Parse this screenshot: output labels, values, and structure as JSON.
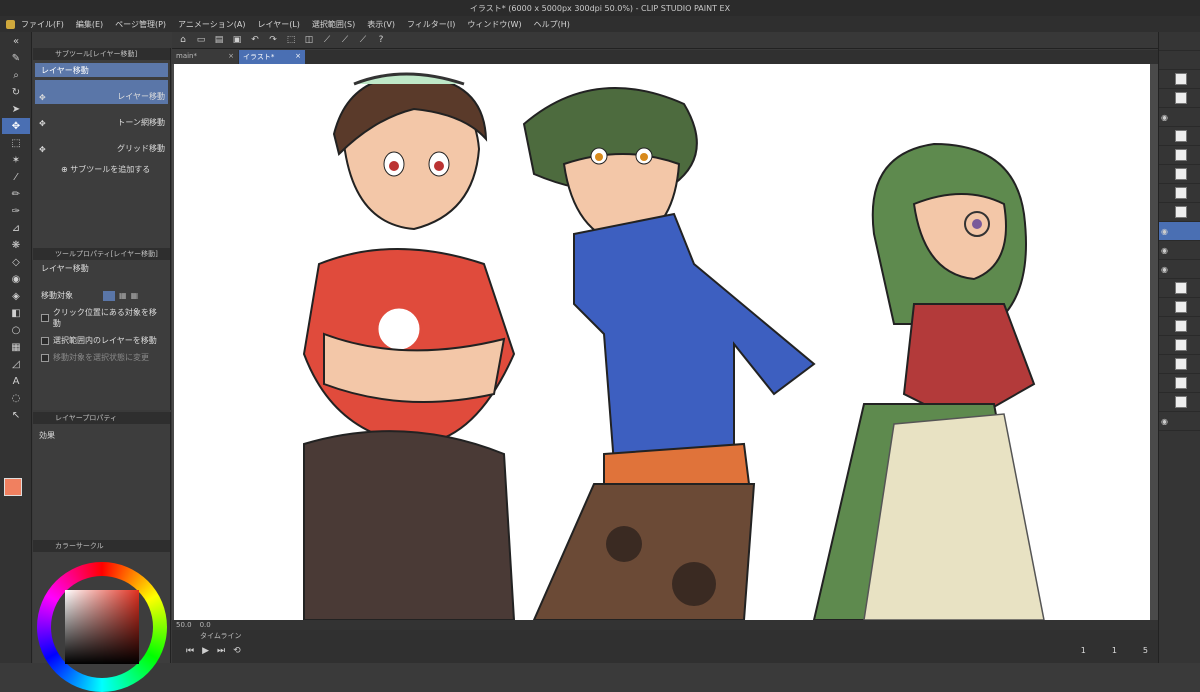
{
  "window": {
    "title": "イラスト* (6000 x 5000px 300dpi 50.0%) - CLIP STUDIO PAINT EX"
  },
  "menu": [
    "ファイル(F)",
    "編集(E)",
    "ページ管理(P)",
    "アニメーション(A)",
    "レイヤー(L)",
    "選択範囲(S)",
    "表示(V)",
    "フィルター(I)",
    "ウィンドウ(W)",
    "ヘルプ(H)"
  ],
  "tabs": [
    {
      "label": "main*"
    },
    {
      "label": "イラスト*"
    }
  ],
  "subtool": {
    "header": "サブツール[レイヤー移動]",
    "group_tab": "レイヤー移動",
    "items": [
      {
        "label": "レイヤー移動"
      },
      {
        "label": "トーン網移動"
      },
      {
        "label": "グリッド移動"
      }
    ],
    "add_label": "サブツールを追加する"
  },
  "tool_property": {
    "header": "ツールプロパティ[レイヤー移動]",
    "name": "レイヤー移動",
    "target_label": "移動対象",
    "options": [
      "クリック位置にある対象を移動",
      "選択範囲内のレイヤーを移動",
      "移動対象を選択状態に変更"
    ]
  },
  "layer_property": {
    "header": "レイヤープロパティ",
    "effect_label": "効果"
  },
  "color_panel": {
    "header": "カラーサークル"
  },
  "status": {
    "zoom": "50.0",
    "angle": "0.0"
  },
  "timeline": {
    "header": "タイムライン",
    "frame_current": "1",
    "frame_start": "1",
    "frame_end": "5"
  },
  "colors": {
    "accent": "#4a6fb3",
    "main_color": "#f08060"
  }
}
